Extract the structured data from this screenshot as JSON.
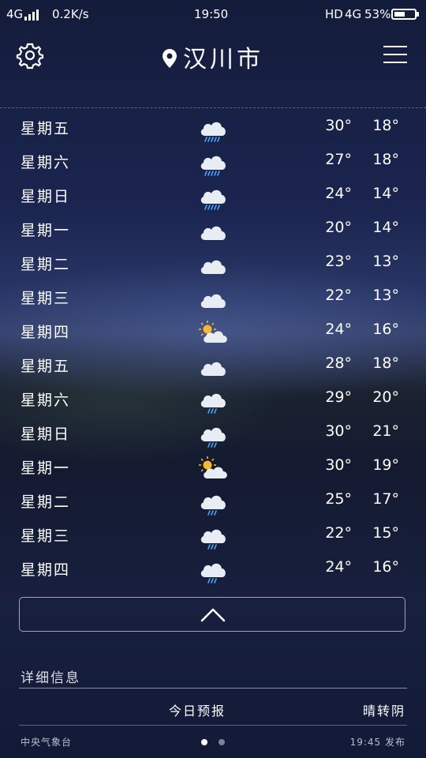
{
  "status_bar": {
    "network": "4G",
    "speed": "0.2K/s",
    "time": "19:50",
    "hd": "HD",
    "network2": "4G",
    "battery": "53%",
    "battery_level": 0.53
  },
  "header": {
    "city": "汉川市",
    "settings_icon": "gear-icon",
    "location_icon": "location-pin-icon",
    "menu_icon": "hamburger-menu-icon"
  },
  "forecast": [
    {
      "day": "星期五",
      "icon": "rain-heavy-icon",
      "high": "30°",
      "low": "18°"
    },
    {
      "day": "星期六",
      "icon": "rain-heavy-icon",
      "high": "27°",
      "low": "18°"
    },
    {
      "day": "星期日",
      "icon": "rain-heavy-icon",
      "high": "24°",
      "low": "14°"
    },
    {
      "day": "星期一",
      "icon": "cloud-icon",
      "high": "20°",
      "low": "14°"
    },
    {
      "day": "星期二",
      "icon": "cloud-icon",
      "high": "23°",
      "low": "13°"
    },
    {
      "day": "星期三",
      "icon": "cloud-icon",
      "high": "22°",
      "low": "13°"
    },
    {
      "day": "星期四",
      "icon": "partly-sunny-icon",
      "high": "24°",
      "low": "16°"
    },
    {
      "day": "星期五",
      "icon": "cloud-icon",
      "high": "28°",
      "low": "18°"
    },
    {
      "day": "星期六",
      "icon": "rain-light-icon",
      "high": "29°",
      "low": "20°"
    },
    {
      "day": "星期日",
      "icon": "rain-light-icon",
      "high": "30°",
      "low": "21°"
    },
    {
      "day": "星期一",
      "icon": "partly-sunny-icon",
      "high": "30°",
      "low": "19°"
    },
    {
      "day": "星期二",
      "icon": "rain-light-icon",
      "high": "25°",
      "low": "17°"
    },
    {
      "day": "星期三",
      "icon": "rain-light-icon",
      "high": "22°",
      "low": "15°"
    },
    {
      "day": "星期四",
      "icon": "rain-light-icon",
      "high": "24°",
      "low": "16°"
    }
  ],
  "collapse_icon": "chevron-up-icon",
  "details": {
    "title": "详细信息",
    "label": "今日预报",
    "value": "晴转阴"
  },
  "footer": {
    "source": "中央气象台",
    "publish_time": "19:45 发布",
    "page_count": 2,
    "active_page": 1
  },
  "colors": {
    "accent": "#ffffff",
    "cloud": "#e8ecf3",
    "rain": "#4aa8ff",
    "sun": "#f5b82e"
  }
}
